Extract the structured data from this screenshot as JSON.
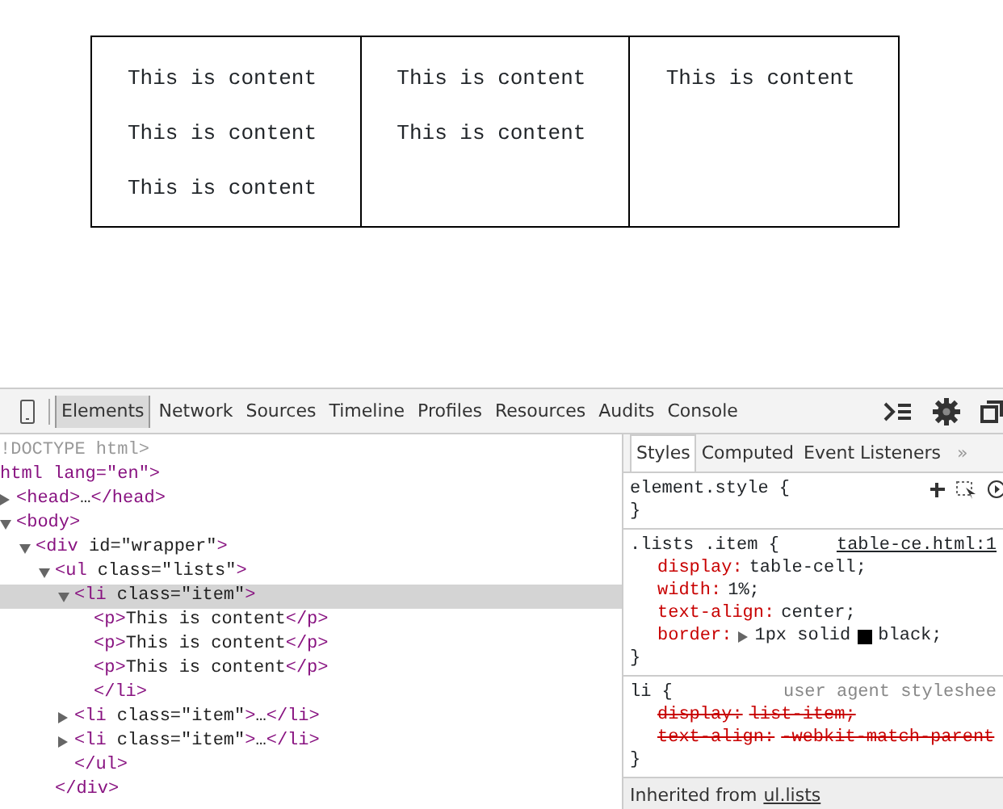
{
  "page": {
    "cells": [
      {
        "paragraphs": [
          "This is content",
          "This is content",
          "This is content"
        ]
      },
      {
        "paragraphs": [
          "This is content",
          "This is content"
        ]
      },
      {
        "paragraphs": [
          "This is content"
        ]
      }
    ]
  },
  "devtools": {
    "tabs": [
      {
        "label": "Elements",
        "selected": true
      },
      {
        "label": "Network",
        "selected": false
      },
      {
        "label": "Sources",
        "selected": false
      },
      {
        "label": "Timeline",
        "selected": false
      },
      {
        "label": "Profiles",
        "selected": false
      },
      {
        "label": "Resources",
        "selected": false
      },
      {
        "label": "Audits",
        "selected": false
      },
      {
        "label": "Console",
        "selected": false
      }
    ],
    "dom_tree": [
      {
        "markup": "!DOCTYPE html>",
        "kind": "doctype",
        "selected": false
      },
      {
        "markup": "html lang=\"en\">",
        "kind": "tag",
        "selected": false,
        "children": [
          {
            "markup": "<head>…</head>",
            "kind": "tag",
            "expanded": false,
            "selected": false
          },
          {
            "markup": "<body>",
            "kind": "tag",
            "expanded": true,
            "selected": false,
            "children": [
              {
                "markup": "<div id=\"wrapper\">",
                "kind": "tag",
                "expanded": true,
                "selected": false,
                "children": [
                  {
                    "markup": "<ul class=\"lists\">",
                    "kind": "tag",
                    "expanded": true,
                    "selected": false,
                    "children": [
                      {
                        "markup": "<li class=\"item\">",
                        "kind": "tag",
                        "expanded": true,
                        "selected": true,
                        "children": [
                          {
                            "markup": "<p>This is content</p>",
                            "kind": "tag",
                            "selected": false
                          },
                          {
                            "markup": "<p>This is content</p>",
                            "kind": "tag",
                            "selected": false
                          },
                          {
                            "markup": "<p>This is content</p>",
                            "kind": "tag",
                            "selected": false
                          },
                          {
                            "markup": "</li>",
                            "kind": "tag",
                            "selected": false
                          }
                        ]
                      },
                      {
                        "markup": "<li class=\"item\">…</li>",
                        "kind": "tag",
                        "expanded": false,
                        "selected": false
                      },
                      {
                        "markup": "<li class=\"item\">…</li>",
                        "kind": "tag",
                        "expanded": false,
                        "selected": false
                      },
                      {
                        "markup": "</ul>",
                        "kind": "tag",
                        "selected": false
                      }
                    ]
                  },
                  {
                    "markup": "</div>",
                    "kind": "tag",
                    "selected": false
                  }
                ]
              }
            ]
          }
        ]
      }
    ],
    "styles_tabs": [
      {
        "label": "Styles",
        "selected": true
      },
      {
        "label": "Computed",
        "selected": false
      },
      {
        "label": "Event Listeners",
        "selected": false
      }
    ],
    "more_tabs": "»",
    "rules": [
      {
        "selector": "element.style {",
        "tools": true,
        "close": "}"
      },
      {
        "selector": ".lists .item {",
        "source": "table-ce.html:1",
        "source_is_link": true,
        "properties": [
          {
            "name": "display:",
            "value": "table-cell;",
            "overridden": false
          },
          {
            "name": "width:",
            "value": "1%;",
            "overridden": false
          },
          {
            "name": "text-align:",
            "value": "center;",
            "overridden": false
          },
          {
            "name": "border:",
            "value": "1px solid",
            "color": "#000000",
            "after_color": "black;",
            "expandable": true,
            "overridden": false
          }
        ],
        "close": "}"
      },
      {
        "selector": "li {",
        "source": "user agent styleshee",
        "source_is_link": false,
        "properties": [
          {
            "name": "display:",
            "value": "list-item;",
            "overridden": true
          },
          {
            "name": "text-align:",
            "value": "-webkit-match-parent",
            "overridden": true
          }
        ],
        "close": "}"
      }
    ],
    "inherited": {
      "text": "Inherited from",
      "link": "ul.lists"
    }
  }
}
